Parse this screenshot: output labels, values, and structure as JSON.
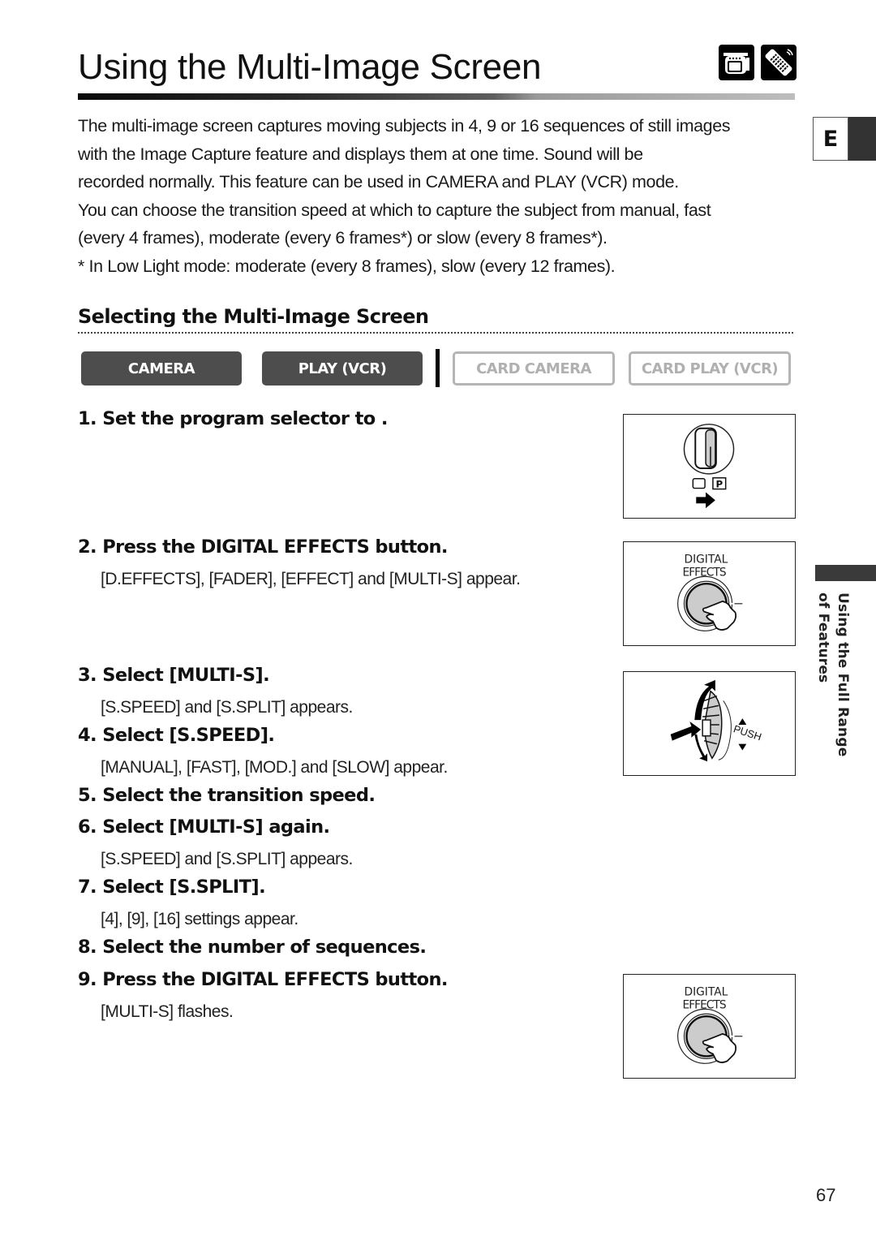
{
  "page": {
    "title": "Using the Multi-Image Screen",
    "header_icons": [
      "camcorder-icon",
      "remote-control-icon"
    ],
    "language_tab": "E",
    "side_tab": {
      "line1": "Using the Full Range",
      "line2": "of Features"
    },
    "page_number": "67"
  },
  "intro": {
    "lines": [
      "The multi-image screen captures moving subjects in 4, 9 or 16 sequences of still images",
      "with the Image Capture feature and displays them at one time. Sound will be",
      "recorded normally. This feature can be used in CAMERA and PLAY (VCR) mode.",
      "You can choose the transition speed at which to capture the subject from manual, fast",
      "(every 4 frames), moderate (every 6 frames*) or slow (every 8 frames*).",
      "* In Low Light mode: moderate (every 8 frames), slow (every 12 frames)."
    ]
  },
  "section": {
    "heading": "Selecting the Multi-Image Screen",
    "modes": [
      {
        "label": "CAMERA",
        "active": true
      },
      {
        "label": "PLAY (VCR)",
        "active": true
      },
      {
        "label": "CARD CAMERA",
        "active": false
      },
      {
        "label": "CARD PLAY (VCR)",
        "active": false
      }
    ]
  },
  "steps": [
    {
      "title": "1. Set the program selector to    .",
      "detail": ""
    },
    {
      "title": "2. Press the DIGITAL EFFECTS button.",
      "detail": "[D.EFFECTS], [FADER], [EFFECT] and [MULTI-S] appear."
    },
    {
      "title": "3. Select [MULTI-S].",
      "detail": "[S.SPEED] and [S.SPLIT] appears."
    },
    {
      "title": "4. Select [S.SPEED].",
      "detail": "[MANUAL], [FAST], [MOD.] and [SLOW] appear."
    },
    {
      "title": "5. Select the transition speed.",
      "detail": ""
    },
    {
      "title": "6. Select [MULTI-S] again.",
      "detail": "[S.SPEED] and [S.SPLIT] appears."
    },
    {
      "title": "7. Select [S.SPLIT].",
      "detail": "[4], [9], [16] settings appear."
    },
    {
      "title": "8. Select the number of sequences.",
      "detail": ""
    },
    {
      "title": "9. Press the DIGITAL EFFECTS button.",
      "detail": "[MULTI-S] flashes."
    }
  ],
  "illustrations": {
    "program_selector": {
      "labels": [
        "P"
      ]
    },
    "digital_effects_1": {
      "label_line1": "DIGITAL",
      "label_line2": "EFFECTS"
    },
    "dial": {
      "label": "PUSH"
    },
    "digital_effects_2": {
      "label_line1": "DIGITAL",
      "label_line2": "EFFECTS"
    }
  }
}
